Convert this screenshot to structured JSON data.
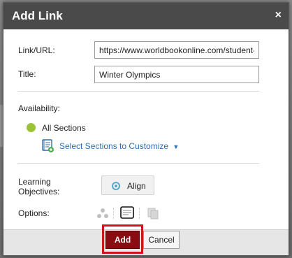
{
  "dialog": {
    "title": "Add Link",
    "close_label": "×"
  },
  "form": {
    "link_label": "Link/URL:",
    "link_value": "https://www.worldbookonline.com/student-",
    "title_label": "Title:",
    "title_value": "Winter Olympics",
    "availability_label": "Availability:",
    "all_sections_label": "All Sections",
    "select_sections_label": "Select Sections to Customize",
    "learning_objectives_label": "Learning\nObjectives:",
    "learning_objectives_line1": "Learning",
    "learning_objectives_line2": "Objectives:",
    "align_label": "Align",
    "options_label": "Options:"
  },
  "footer": {
    "add_label": "Add",
    "cancel_label": "Cancel"
  },
  "icons": {
    "availability_dot": "status-dot-icon",
    "select_sections": "sections-calendar-icon",
    "align": "target-icon",
    "options": [
      "visibility-share-icon",
      "new-window-icon",
      "copy-icon"
    ]
  },
  "colors": {
    "titlebar": "#4a4a4a",
    "accent_green": "#9bc33a",
    "link_blue": "#2a6eb3",
    "add_button": "#8b0b12",
    "highlight": "#d0141d"
  }
}
